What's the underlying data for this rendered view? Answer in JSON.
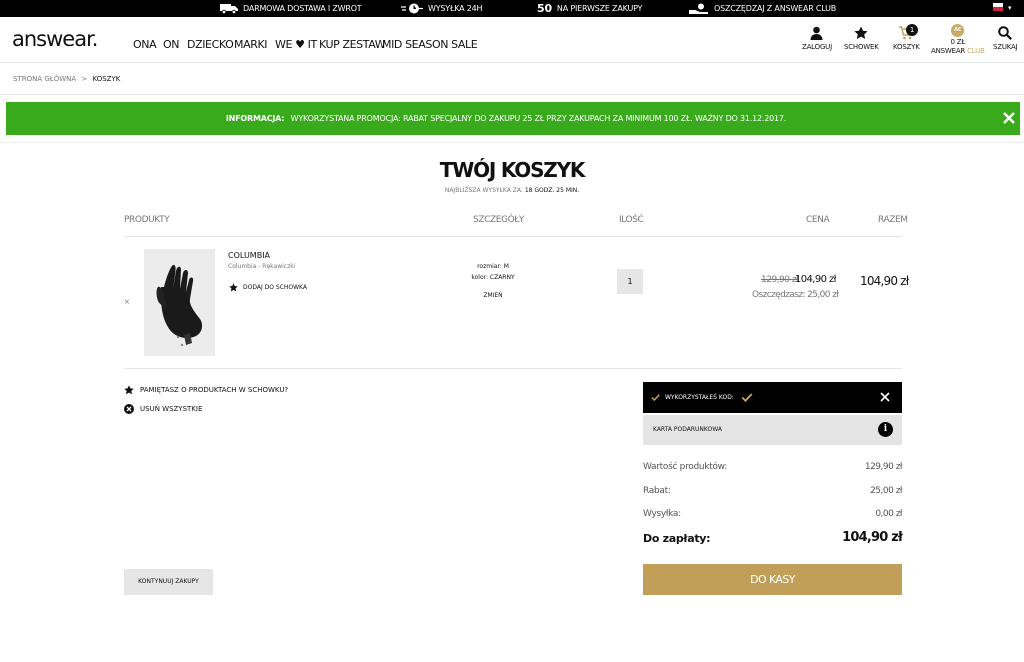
{
  "topbar": {
    "perks": [
      {
        "icon": "truck-icon",
        "label": "Darmowa dostawa i zwrot"
      },
      {
        "icon": "fast-delivery-icon",
        "label": "Wysyłka 24h"
      },
      {
        "icon": "discount-icon",
        "number": "50",
        "label": "Na pierwsze zakupy"
      },
      {
        "icon": "hand-coin-icon",
        "label": "Oszczędzaj z Answear Club"
      }
    ],
    "country_flag": "pl-flag-icon"
  },
  "header": {
    "logo": "answear.",
    "nav": [
      "ONA",
      "ON",
      "DZIECKO",
      "MARKI",
      "WE ♥ IT",
      "KUP ZESTAW",
      "MID SEASON SALE"
    ],
    "actions": {
      "login": "Zaloguj",
      "wishlist": "Schowek",
      "cart": "Koszyk",
      "cart_count": "1",
      "club_coin": "AC",
      "club_points": "0 zł",
      "club_label_a": "Answear",
      "club_label_b": "Club",
      "search": "Szukaj"
    }
  },
  "breadcrumb": {
    "home": "Strona główna",
    "sep": ">",
    "current": "Koszyk"
  },
  "banner": {
    "label": "Informacja:",
    "text": "Wykorzystana promocja: Rabat specjalny do zakupu 25 zł przy zakupach za minimum 100 zł. Ważny do 31.12.2017."
  },
  "cart": {
    "title": "Twój koszyk",
    "shipping_prefix": "Najbliższa wysyłka za:",
    "shipping_time": "18 godz. 25 min.",
    "columns": {
      "products": "Produkty",
      "details": "Szczegóły",
      "qty": "Ilość",
      "price": "Cena",
      "total": "Razem"
    },
    "item": {
      "remove": "×",
      "brand": "COLUMBIA",
      "name": "Columbia - Rękawiczki",
      "wishlist": "Dodaj do schowka",
      "size": "rozmiar: M",
      "color": "kolor: CZARNY",
      "change": "Zmień",
      "qty": "1",
      "old_price": "129,90 zł",
      "price": "104,90 zł",
      "saving": "Oszczędzasz: 25,00 zł",
      "total": "104,90 zł"
    },
    "actions": {
      "remember": "Pamiętasz o produktach w schowku?",
      "remove_all": "Usuń wszystkie",
      "continue": "Kontynuuj zakupy"
    }
  },
  "summary": {
    "code_used": "Wykorzystałeś kod:",
    "gift_card": "Karta podarunkowa",
    "rows": [
      {
        "label": "Wartość produktów:",
        "value": "129,90 zł"
      },
      {
        "label": "Rabat:",
        "value": "25,00 zł"
      },
      {
        "label": "Wysyłka:",
        "value": "0,00 zł"
      }
    ],
    "to_pay_label": "Do zapłaty:",
    "to_pay_value": "104,90 zł",
    "checkout": "Do kasy"
  },
  "colors": {
    "accent_gold": "#c19f58",
    "banner_green": "#3aaa1d",
    "topbar": "#000000"
  }
}
